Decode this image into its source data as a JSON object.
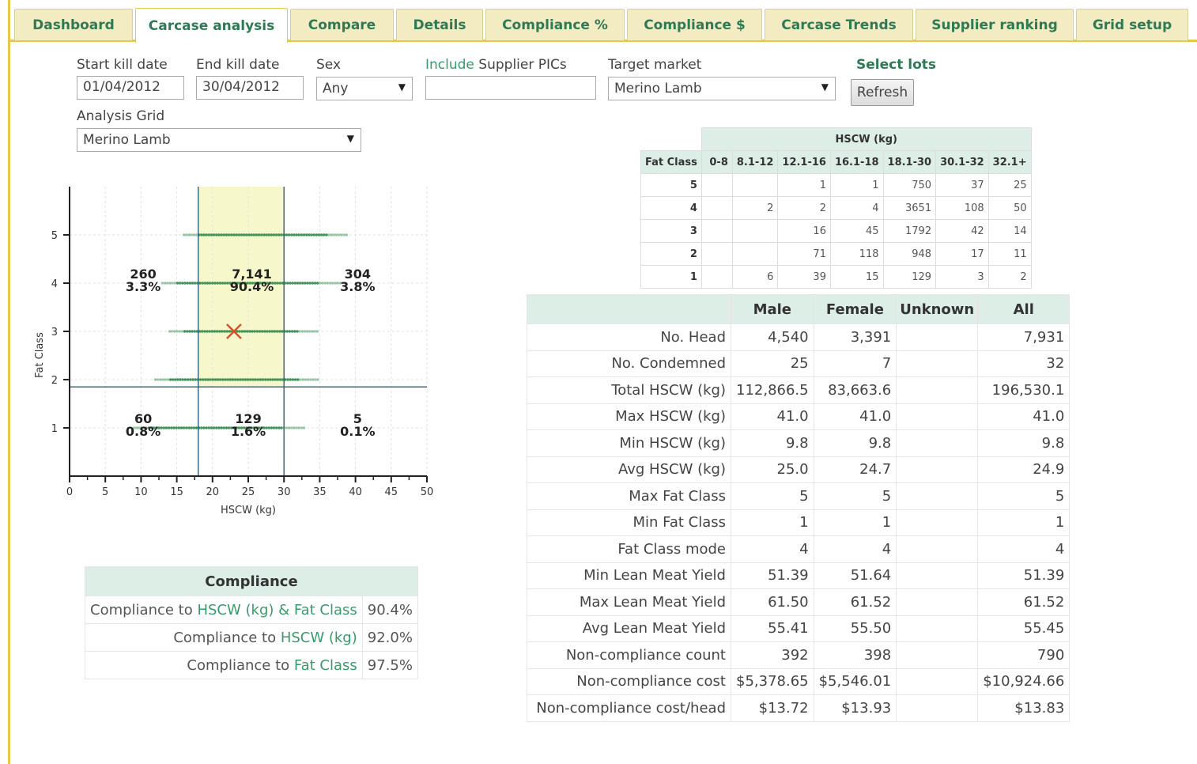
{
  "tabs": [
    "Dashboard",
    "Carcase analysis",
    "Compare",
    "Details",
    "Compliance %",
    "Compliance $",
    "Carcase Trends",
    "Supplier ranking",
    "Grid setup"
  ],
  "active_tab": "Carcase analysis",
  "filters": {
    "start_label": "Start kill date",
    "start_value": "01/04/2012",
    "end_label": "End kill date",
    "end_value": "30/04/2012",
    "sex_label": "Sex",
    "sex_value": "Any",
    "include_label_1": "Include",
    "include_label_2": " Supplier PICs",
    "include_value": "",
    "target_label": "Target market",
    "target_value": "Merino Lamb",
    "select_lots": "Select lots",
    "refresh": "Refresh",
    "grid_label": "Analysis Grid",
    "grid_value": "Merino Lamb"
  },
  "hscw_table": {
    "title": "HSCW (kg)",
    "row_header": "Fat Class",
    "columns": [
      "0-8",
      "8.1-12",
      "12.1-16",
      "16.1-18",
      "18.1-30",
      "30.1-32",
      "32.1+"
    ],
    "rows": [
      {
        "fat": "5",
        "vals": [
          "",
          "",
          "1",
          "1",
          "750",
          "37",
          "25"
        ]
      },
      {
        "fat": "4",
        "vals": [
          "",
          "2",
          "2",
          "4",
          "3651",
          "108",
          "50"
        ]
      },
      {
        "fat": "3",
        "vals": [
          "",
          "",
          "16",
          "45",
          "1792",
          "42",
          "14"
        ]
      },
      {
        "fat": "2",
        "vals": [
          "",
          "",
          "71",
          "118",
          "948",
          "17",
          "11"
        ]
      },
      {
        "fat": "1",
        "vals": [
          "",
          "6",
          "39",
          "15",
          "129",
          "3",
          "2"
        ]
      }
    ]
  },
  "stats_table": {
    "columns": [
      "Male",
      "Female",
      "Unknown",
      "All"
    ],
    "rows": [
      {
        "label": "No. Head",
        "vals": [
          "4,540",
          "3,391",
          "",
          "7,931"
        ]
      },
      {
        "label": "No. Condemned",
        "vals": [
          "25",
          "7",
          "",
          "32"
        ]
      },
      {
        "label": "Total HSCW (kg)",
        "vals": [
          "112,866.5",
          "83,663.6",
          "",
          "196,530.1"
        ]
      },
      {
        "label": "Max HSCW (kg)",
        "vals": [
          "41.0",
          "41.0",
          "",
          "41.0"
        ]
      },
      {
        "label": "Min HSCW (kg)",
        "vals": [
          "9.8",
          "9.8",
          "",
          "9.8"
        ]
      },
      {
        "label": "Avg HSCW (kg)",
        "vals": [
          "25.0",
          "24.7",
          "",
          "24.9"
        ]
      },
      {
        "label": "Max Fat Class",
        "vals": [
          "5",
          "5",
          "",
          "5"
        ]
      },
      {
        "label": "Min Fat Class",
        "vals": [
          "1",
          "1",
          "",
          "1"
        ]
      },
      {
        "label": "Fat Class mode",
        "vals": [
          "4",
          "4",
          "",
          "4"
        ]
      },
      {
        "label": "Min Lean Meat Yield",
        "vals": [
          "51.39",
          "51.64",
          "",
          "51.39"
        ]
      },
      {
        "label": "Max Lean Meat Yield",
        "vals": [
          "61.50",
          "61.52",
          "",
          "61.52"
        ]
      },
      {
        "label": "Avg Lean Meat Yield",
        "vals": [
          "55.41",
          "55.50",
          "",
          "55.45"
        ]
      },
      {
        "label": "Non-compliance count",
        "vals": [
          "392",
          "398",
          "",
          "790"
        ]
      },
      {
        "label": "Non-compliance cost",
        "vals": [
          "$5,378.65",
          "$5,546.01",
          "",
          "$10,924.66"
        ]
      },
      {
        "label": "Non-compliance cost/head",
        "vals": [
          "$13.72",
          "$13.93",
          "",
          "$13.83"
        ]
      }
    ]
  },
  "compliance": {
    "title": "Compliance",
    "rows": [
      {
        "prefix": "Compliance to ",
        "link": "HSCW (kg) & Fat Class",
        "value": "90.4%"
      },
      {
        "prefix": "Compliance to ",
        "link": "HSCW (kg)",
        "value": "92.0%"
      },
      {
        "prefix": "Compliance to ",
        "link": "Fat Class",
        "value": "97.5%"
      }
    ]
  },
  "chart_data": {
    "type": "scatter",
    "xlabel": "HSCW (kg)",
    "ylabel": "Fat Class",
    "xlim": [
      0,
      50
    ],
    "ylim": [
      0,
      6
    ],
    "xticks": [
      0,
      5,
      10,
      15,
      20,
      25,
      30,
      35,
      40,
      45,
      50
    ],
    "yticks": [
      1,
      2,
      3,
      4,
      5
    ],
    "target_hscw_range": [
      18,
      30
    ],
    "target_fat_min": 1.85,
    "mean_marker": {
      "x": 23,
      "y": 3
    },
    "point_bands": [
      {
        "y": 5,
        "x_from": 16,
        "x_to": 39
      },
      {
        "y": 4,
        "x_from": 13,
        "x_to": 38
      },
      {
        "y": 3,
        "x_from": 14,
        "x_to": 35
      },
      {
        "y": 2,
        "x_from": 12,
        "x_to": 35
      },
      {
        "y": 1,
        "x_from": 9,
        "x_to": 33
      }
    ],
    "region_labels": [
      {
        "count": "260",
        "pct": "3.3%",
        "x": 10.3,
        "y": 4
      },
      {
        "count": "7,141",
        "pct": "90.4%",
        "x": 25.5,
        "y": 4
      },
      {
        "count": "304",
        "pct": "3.8%",
        "x": 40.3,
        "y": 4
      },
      {
        "count": "60",
        "pct": "0.8%",
        "x": 10.3,
        "y": 1
      },
      {
        "count": "129",
        "pct": "1.6%",
        "x": 25,
        "y": 1
      },
      {
        "count": "5",
        "pct": "0.1%",
        "x": 40.3,
        "y": 1
      }
    ],
    "colors": {
      "target_fill": "#f6f8cc",
      "points": "#2f8a4a",
      "lines": "#2d5f7a",
      "marker": "#d2542d"
    }
  }
}
